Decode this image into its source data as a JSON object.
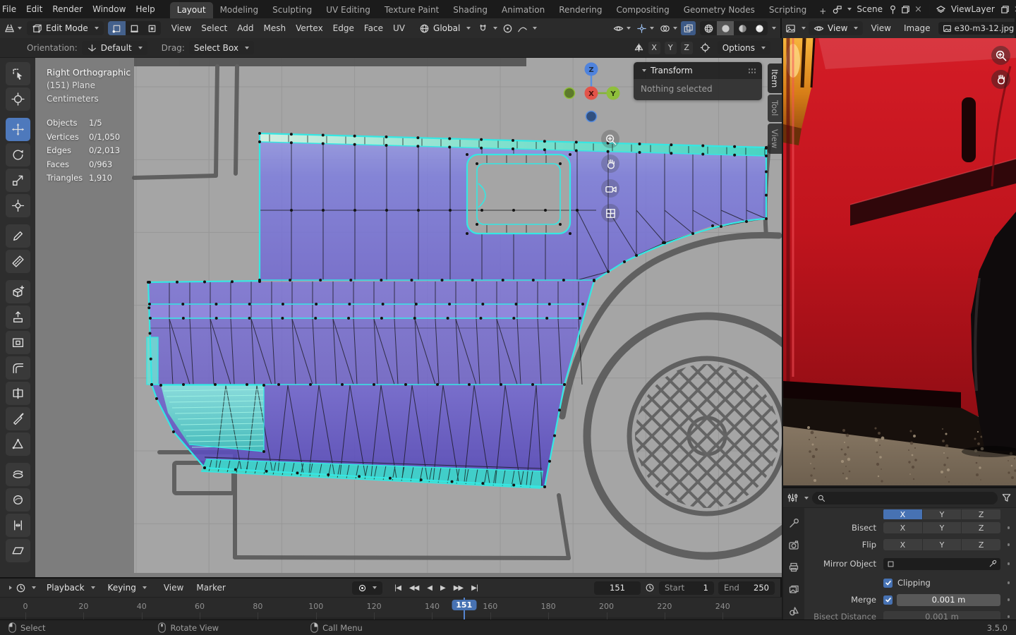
{
  "topbar": {
    "menus": [
      "File",
      "Edit",
      "Render",
      "Window",
      "Help"
    ],
    "workspaces": [
      "Layout",
      "Modeling",
      "Sculpting",
      "UV Editing",
      "Texture Paint",
      "Shading",
      "Animation",
      "Rendering",
      "Compositing",
      "Geometry Nodes",
      "Scripting"
    ],
    "add_workspace": "+",
    "scene": {
      "label": "Scene"
    },
    "viewlayer": {
      "label": "ViewLayer"
    }
  },
  "viewport_header": {
    "mode": "Edit Mode",
    "menus": [
      "View",
      "Select",
      "Add",
      "Mesh",
      "Vertex",
      "Edge",
      "Face",
      "UV"
    ],
    "orientation": "Global"
  },
  "image_editor_header": {
    "mode": "View",
    "menus": [
      "View",
      "Image"
    ],
    "filename": "e30-m3-12.jpg"
  },
  "tool_settings": {
    "orientation_label": "Orientation:",
    "orientation_value": "Default",
    "drag_label": "Drag:",
    "drag_value": "Select Box",
    "mirror_axes": [
      "X",
      "Y",
      "Z"
    ],
    "options_label": "Options"
  },
  "viewport": {
    "view_name": "Right Orthographic",
    "active_object": "(151) Plane",
    "units": "Centimeters",
    "stats": {
      "rows": [
        {
          "label": "Objects",
          "value": "1/5"
        },
        {
          "label": "Vertices",
          "value": "0/1,050"
        },
        {
          "label": "Edges",
          "value": "0/2,013"
        },
        {
          "label": "Faces",
          "value": "0/963"
        },
        {
          "label": "Triangles",
          "value": "1,910"
        }
      ]
    },
    "gizmo": {
      "x": "X",
      "y": "Y",
      "z": "Z"
    },
    "transform_panel": {
      "title": "Transform",
      "message": "Nothing selected"
    },
    "sidebar_tabs": [
      "Item",
      "Tool",
      "View"
    ]
  },
  "properties_panel": {
    "axis_row": {
      "buttons": [
        "X",
        "Y",
        "Z"
      ]
    },
    "bisect_label": "Bisect",
    "bisect_buttons": [
      "X",
      "Y",
      "Z"
    ],
    "flip_label": "Flip",
    "flip_buttons": [
      "X",
      "Y",
      "Z"
    ],
    "mirror_object_label": "Mirror Object",
    "clipping_label": "Clipping",
    "merge_label": "Merge",
    "merge_value": "0.001 m",
    "bisect_distance_label": "Bisect Distance",
    "bisect_distance_value": "0.001 m"
  },
  "timeline": {
    "playback": "Playback",
    "keying": "Keying",
    "view": "View",
    "marker": "Marker",
    "transport": [
      "|◀",
      "◀◀",
      "◀",
      "▶",
      "▶▶",
      "▶|"
    ],
    "current_frame": "151",
    "start_label": "Start",
    "start_value": "1",
    "end_label": "End",
    "end_value": "250",
    "ticks": [
      0,
      20,
      40,
      60,
      80,
      100,
      120,
      140,
      160,
      180,
      200,
      220,
      240
    ],
    "playhead_frame": 151
  },
  "status_bar": {
    "select_hint": "Select",
    "rotate_hint": "Rotate View",
    "menu_hint": "Call Menu",
    "version": "3.5.0"
  },
  "colors": {
    "accent": "#4772b3",
    "selected_edge": "#35e7e3",
    "mesh_face": "#7c7ce2"
  }
}
